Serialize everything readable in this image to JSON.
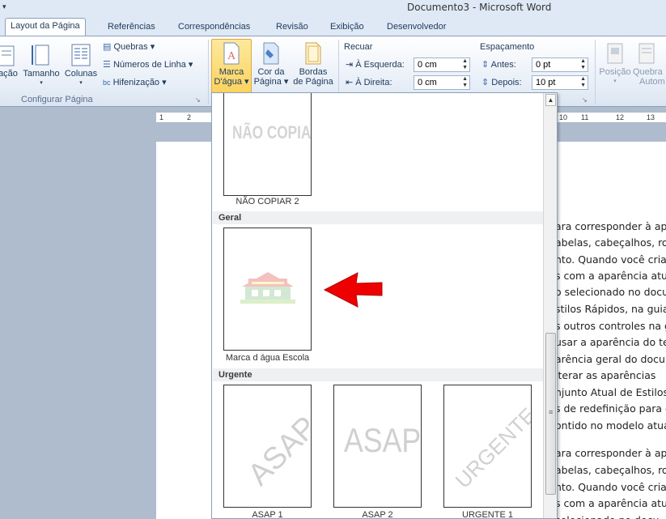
{
  "window": {
    "title": "Documento3 - Microsoft Word",
    "quick_access_glyph": "▾"
  },
  "tabs": [
    {
      "label": "Layout da Página",
      "active": true
    },
    {
      "label": "Referências"
    },
    {
      "label": "Correspondências"
    },
    {
      "label": "Revisão"
    },
    {
      "label": "Exibição"
    },
    {
      "label": "Desenvolvedor"
    }
  ],
  "ribbon": {
    "page_setup": {
      "orientation_partial": "ação",
      "size": "Tamanho",
      "columns": "Colunas",
      "breaks": "Quebras",
      "line_numbers": "Números de Linha",
      "hyphenation": "Hifenização",
      "group_label": "Configurar Página"
    },
    "page_background": {
      "watermark_line1": "Marca",
      "watermark_line2": "D'água",
      "page_color_line1": "Cor da",
      "page_color_line2": "Página",
      "borders_line1": "Bordas",
      "borders_line2": "de Página"
    },
    "paragraph": {
      "indent_title": "Recuar",
      "left_label": "À Esquerda:",
      "left_value": "0 cm",
      "right_label": "À Direita:",
      "right_value": "0 cm",
      "spacing_title": "Espaçamento",
      "before_label": "Antes:",
      "before_value": "0 pt",
      "after_label": "Depois:",
      "after_value": "10 pt"
    },
    "arrange": {
      "position_label": "Posição",
      "wrap_line1": "Quebra",
      "wrap_line2": "Autom"
    }
  },
  "ruler": {
    "numbers": [
      "1",
      "2",
      "10",
      "11",
      "12",
      "13"
    ]
  },
  "gallery": {
    "sections": [
      {
        "title": "Geral"
      },
      {
        "title": "Urgente"
      }
    ],
    "items": [
      {
        "caption": "NÃO COPIAR 2",
        "watermark_text": "NÃO COPIAR"
      },
      {
        "caption": "Marca d água Escola",
        "watermark_text": ""
      },
      {
        "caption": "ASAP 1",
        "watermark_text": "ASAP"
      },
      {
        "caption": "ASAP 2",
        "watermark_text": "ASAP"
      },
      {
        "caption": "URGENTE 1",
        "watermark_text": "URGENTE"
      }
    ],
    "scroll_up_glyph": "▲",
    "scroll_grip_glyph": "≡"
  },
  "document": {
    "lines": [
      "ara corresponder à apa",
      "abelas, cabeçalhos, ro",
      "nto. Quando você cria i",
      "s com a aparência atu",
      "o selecionado no docun",
      "stilos Rápidos, na guia",
      "s outros controles na g",
      "usar a aparência do te",
      "arência geral do docur",
      "lterar as aparências",
      "njunto Atual de Estilos",
      "s de redefinição para o",
      "ontido no modelo atua",
      "ara corresponder à apa",
      "abelas, cabeçalhos, ro",
      "nto. Quando você cria i",
      "s com a aparência atu",
      "selecionado no docu"
    ]
  },
  "colors": {
    "accent_highlight": "#fbd35e",
    "arrow_red": "#e00000"
  }
}
